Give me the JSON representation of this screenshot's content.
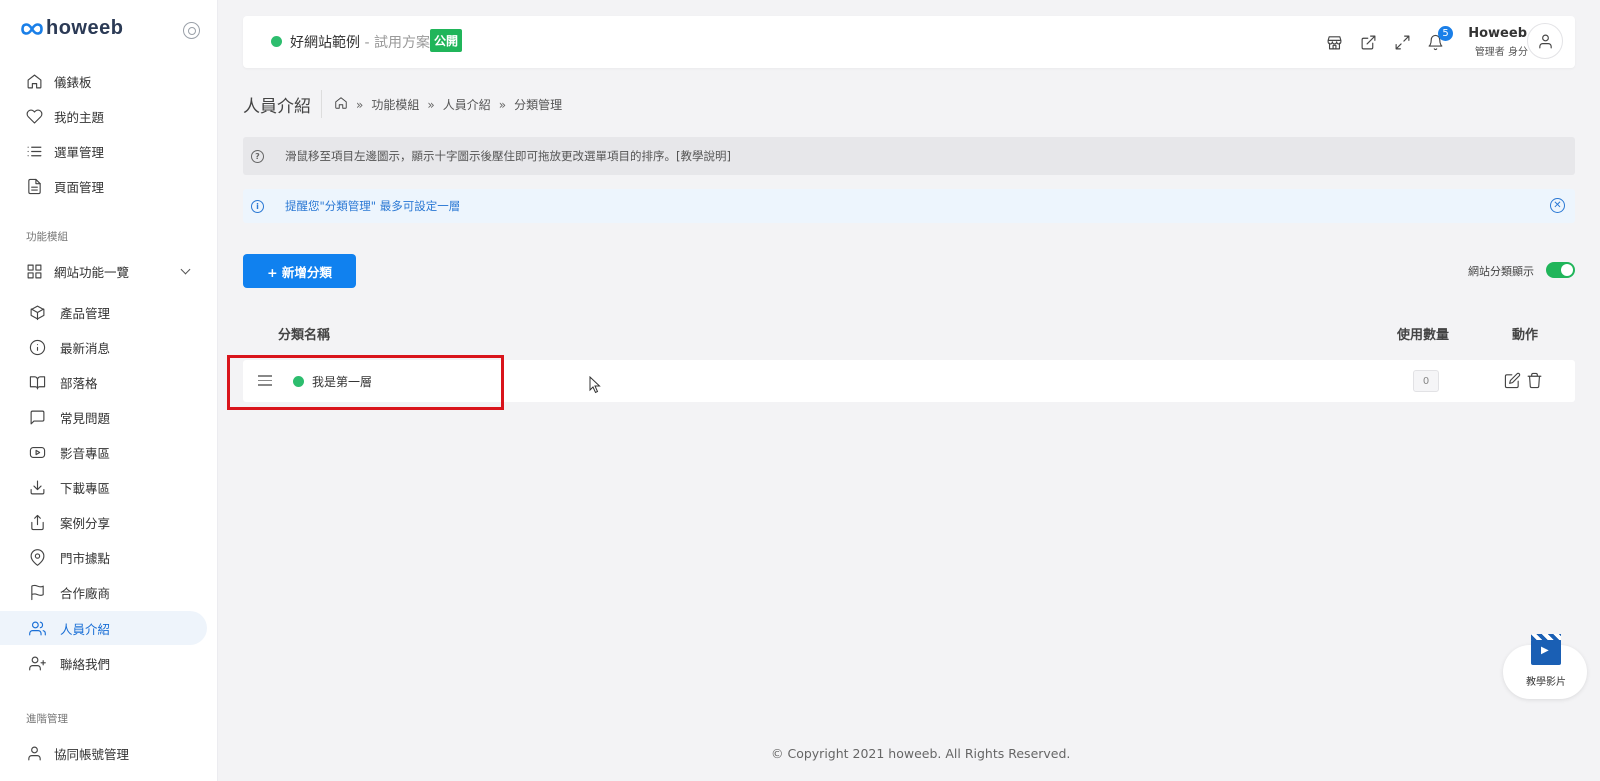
{
  "brand": {
    "name": "howeeb"
  },
  "sidebar": {
    "top_items": [
      {
        "label": "儀錶板",
        "icon": "home-icon"
      },
      {
        "label": "我的主題",
        "icon": "heart-icon"
      },
      {
        "label": "選單管理",
        "icon": "list-icon"
      },
      {
        "label": "頁面管理",
        "icon": "file-icon"
      }
    ],
    "module_section": "功能模組",
    "module_group": {
      "label": "網站功能一覽",
      "icon": "grid-icon"
    },
    "module_items": [
      {
        "label": "產品管理",
        "icon": "box-icon"
      },
      {
        "label": "最新消息",
        "icon": "info-icon"
      },
      {
        "label": "部落格",
        "icon": "book-icon"
      },
      {
        "label": "常見問題",
        "icon": "message-icon"
      },
      {
        "label": "影音專區",
        "icon": "youtube-icon"
      },
      {
        "label": "下載專區",
        "icon": "download-icon"
      },
      {
        "label": "案例分享",
        "icon": "share-icon"
      },
      {
        "label": "門市據點",
        "icon": "map-pin-icon"
      },
      {
        "label": "合作廠商",
        "icon": "flag-icon"
      },
      {
        "label": "人員介紹",
        "icon": "users-icon",
        "active": true
      },
      {
        "label": "聯絡我們",
        "icon": "user-plus-icon"
      }
    ],
    "admin_section": "進階管理",
    "admin_items": [
      {
        "label": "協同帳號管理",
        "icon": "user-icon"
      }
    ]
  },
  "topbar": {
    "site_name": "好網站範例",
    "site_plan": " - 試用方案",
    "public_badge": "公開",
    "notification_count": "5",
    "user_name": "Howeeb",
    "user_role": "管理者 身分"
  },
  "page": {
    "title": "人員介紹",
    "breadcrumb": [
      "功能模組",
      "人員介紹",
      "分類管理"
    ],
    "breadcrumb_sep": "»"
  },
  "alerts": {
    "hint": "滑鼠移至項目左邊圖示，顯示十字圖示後壓住即可拖放更改選單項目的排序。[教學說明]",
    "info": "提醒您\"分類管理\" 最多可設定一層"
  },
  "actions": {
    "add_category": "+ 新增分類",
    "toggle_label": "網站分類顯示",
    "toggle_on": true
  },
  "table": {
    "columns": {
      "name": "分類名稱",
      "count": "使用數量",
      "actions": "動作"
    },
    "rows": [
      {
        "name": "我是第一層",
        "count": "0",
        "status_color": "#2dbd6e"
      }
    ]
  },
  "footer": "© Copyright 2021 howeeb. All Rights Reserved.",
  "video_widget": {
    "label": "教學影片"
  },
  "colors": {
    "primary": "#1081ef",
    "success": "#20b55a",
    "highlight": "#d9141b"
  }
}
